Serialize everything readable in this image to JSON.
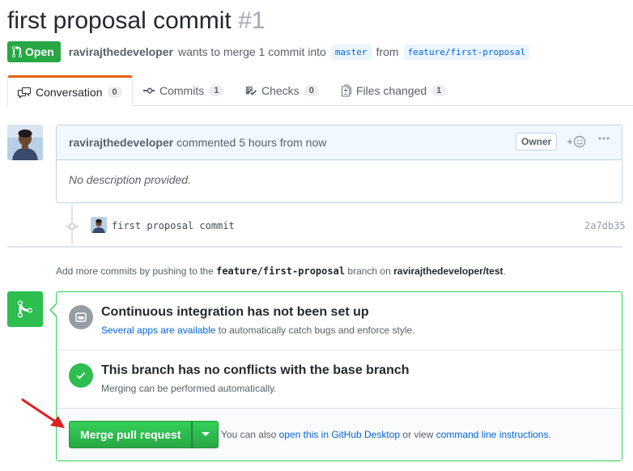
{
  "pr": {
    "title": "first proposal commit",
    "number": "#1",
    "state": "Open",
    "author": "ravirajthedeveloper",
    "merge_text": "wants to merge 1 commit into",
    "base_branch": "master",
    "from_text": "from",
    "head_branch": "feature/first-proposal"
  },
  "tabs": [
    {
      "label": "Conversation",
      "count": "0"
    },
    {
      "label": "Commits",
      "count": "1"
    },
    {
      "label": "Checks",
      "count": "0"
    },
    {
      "label": "Files changed",
      "count": "1"
    }
  ],
  "comment": {
    "author": "ravirajthedeveloper",
    "time": "commented 5 hours from now",
    "badge": "Owner",
    "body": "No description provided."
  },
  "commit": {
    "message": "first proposal commit",
    "sha": "2a7db35"
  },
  "hint": {
    "prefix": "Add more commits by pushing to the",
    "branch": "feature/first-proposal",
    "middle": "branch on",
    "repo": "ravirajthedeveloper/test",
    "suffix": "."
  },
  "merge": {
    "ci_title": "Continuous integration has not been set up",
    "ci_link": "Several apps are available",
    "ci_rest": "to automatically catch bugs and enforce style.",
    "conflict_title": "This branch has no conflicts with the base branch",
    "conflict_sub": "Merging can be performed automatically.",
    "button": "Merge pull request",
    "also_prefix": "You can also",
    "desktop_link": "open this in GitHub Desktop",
    "or_view": "or view",
    "cli_link": "command line instructions",
    "period": "."
  },
  "colors": {
    "open_green": "#28a745",
    "link_blue": "#0366d6",
    "tab_accent": "#e36209",
    "annotation_arrow": "#e02020"
  }
}
